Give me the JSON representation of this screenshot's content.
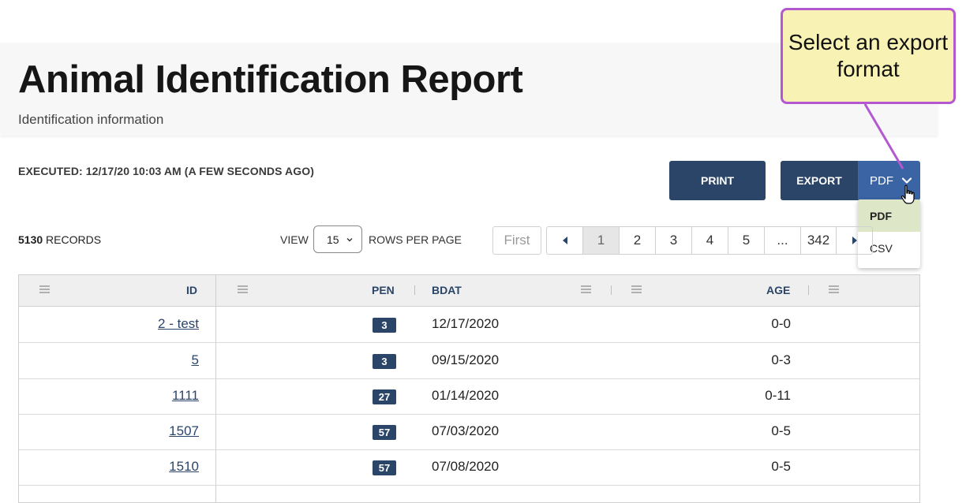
{
  "header": {
    "title": "Animal Identification Report",
    "subtitle": "Identification information"
  },
  "executed": "EXECUTED: 12/17/20 10:03 AM (A FEW SECONDS AGO)",
  "toolbar": {
    "print_label": "PRINT",
    "export_label": "EXPORT",
    "export_format_selected": "PDF",
    "export_options": [
      "PDF",
      "CSV"
    ]
  },
  "records": {
    "count": "5130",
    "suffix": " RECORDS"
  },
  "view": {
    "label": "VIEW",
    "rows_value": "15",
    "rows_label": "ROWS PER PAGE"
  },
  "pagination": {
    "first": "First",
    "pages": [
      "1",
      "2",
      "3",
      "4",
      "5",
      "...",
      "342"
    ],
    "current": "1"
  },
  "table": {
    "columns": [
      "ID",
      "PEN",
      "BDAT",
      "AGE"
    ],
    "rows": [
      {
        "id": "2 - test",
        "pen": "3",
        "bdat": "12/17/2020",
        "age": "0-0"
      },
      {
        "id": "5",
        "pen": "3",
        "bdat": "09/15/2020",
        "age": "0-3"
      },
      {
        "id": "1111",
        "pen": "27",
        "bdat": "01/14/2020",
        "age": "0-11"
      },
      {
        "id": "1507",
        "pen": "57",
        "bdat": "07/03/2020",
        "age": "0-5"
      },
      {
        "id": "1510",
        "pen": "57",
        "bdat": "07/08/2020",
        "age": "0-5"
      }
    ]
  },
  "callout": {
    "text": "Select an export format"
  },
  "colors": {
    "primary": "#2b4569",
    "export_select": "#3a64a4",
    "selected_option": "#dde6c7",
    "callout_fill": "#f8f3b4",
    "callout_border": "#b458d2"
  }
}
